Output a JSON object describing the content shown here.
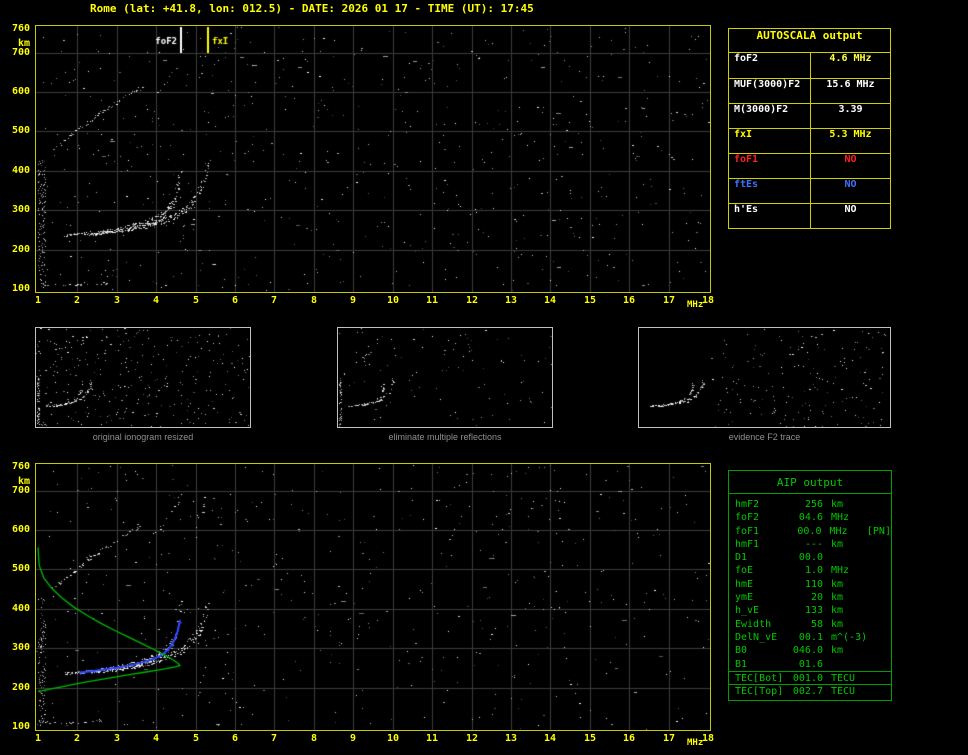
{
  "title": "Rome (lat: +41.8, lon: 012.5) - DATE: 2026 01 17 - TIME (UT): 17:45",
  "colors": {
    "background": "#000000",
    "title_text": "#ffff00",
    "axis_text": "#ffff00",
    "plot_border": "#c8c800",
    "grid_line": "#3c3c3c",
    "echo_dots": "#ffffff",
    "autoscala_border": "#d0d000",
    "aip_green": "#00c800",
    "restored_trace_blue": "#2b46ff",
    "profile_green": "#00bb00",
    "caption_gray": "#8f8f8f",
    "no_red": "#ff2020",
    "es_blue": "#4070ff"
  },
  "autoscala_table": {
    "header": "AUTOSCALA output",
    "rows": [
      {
        "label": "foF2",
        "value": "4.6 MHz",
        "label_color": "#ffffff",
        "value_color": "#ffff40"
      },
      {
        "label": "MUF(3000)F2",
        "value": "15.6 MHz",
        "label_color": "#ffffff",
        "value_color": "#ffffff"
      },
      {
        "label": "M(3000)F2",
        "value": "3.39",
        "label_color": "#ffffff",
        "value_color": "#ffffff"
      },
      {
        "label": "fxI",
        "value": "5.3 MHz",
        "label_color": "#ffff00",
        "value_color": "#ffff00"
      },
      {
        "label": "foF1",
        "value": "NO",
        "label_color": "#ff2020",
        "value_color": "#ff2020"
      },
      {
        "label": "ftEs",
        "value": "NO",
        "label_color": "#4070ff",
        "value_color": "#4070ff"
      },
      {
        "label": "h'Es",
        "value": "NO",
        "label_color": "#ffffff",
        "value_color": "#ffffff"
      }
    ]
  },
  "aip_table": {
    "header": "AIP output",
    "rows": [
      {
        "name": "hmF2",
        "value": "256",
        "unit": "km",
        "extra": ""
      },
      {
        "name": "foF2",
        "value": "04.6",
        "unit": "MHz",
        "extra": ""
      },
      {
        "name": "foF1",
        "value": "00.0",
        "unit": "MHz",
        "extra": "[PN]"
      },
      {
        "name": "hmF1",
        "value": "---",
        "unit": "km",
        "extra": ""
      },
      {
        "name": "D1",
        "value": "00.0",
        "unit": "",
        "extra": ""
      },
      {
        "name": "foE",
        "value": "1.0",
        "unit": "MHz",
        "extra": ""
      },
      {
        "name": "hmE",
        "value": "110",
        "unit": "km",
        "extra": ""
      },
      {
        "name": "ymE",
        "value": "20",
        "unit": "km",
        "extra": ""
      },
      {
        "name": "h_vE",
        "value": "133",
        "unit": "km",
        "extra": ""
      },
      {
        "name": "Ewidth",
        "value": "58",
        "unit": "km",
        "extra": ""
      },
      {
        "name": "DelN_vE",
        "value": "00.1",
        "unit": "m^(-3)",
        "extra": ""
      },
      {
        "name": "B0",
        "value": "046.0",
        "unit": "km",
        "extra": ""
      },
      {
        "name": "B1",
        "value": "01.6",
        "unit": "",
        "extra": ""
      },
      {
        "name": "TEC[Bot]",
        "value": "001.0",
        "unit": "TECU",
        "extra": "",
        "sep_before": true
      },
      {
        "name": "TEC[Top]",
        "value": "002.7",
        "unit": "TECU",
        "extra": "",
        "sep_before": true
      }
    ]
  },
  "chart_data": [
    {
      "id": "ionogram",
      "type": "scatter",
      "title": "",
      "xlim": [
        1,
        18
      ],
      "ylim": [
        100,
        760
      ],
      "xticks": [
        1,
        2,
        3,
        4,
        5,
        6,
        7,
        8,
        9,
        10,
        11,
        12,
        13,
        14,
        15,
        16,
        17,
        18
      ],
      "yticks": [
        760,
        700,
        600,
        500,
        400,
        300,
        200,
        100
      ],
      "unit_x": "MHz",
      "unit_y": "km",
      "grid": true,
      "noise_dots": 650,
      "noise_band": {
        "f": [
          1.0,
          1.18
        ],
        "km": [
          100,
          430
        ],
        "count": 140
      },
      "annotations": [
        {
          "label": "foF2",
          "x_mhz": 4.6,
          "color": "#ffffff",
          "side": "left"
        },
        {
          "label": "fxI",
          "x_mhz": 5.3,
          "color": "#ffff00",
          "side": "right"
        }
      ],
      "series": [
        {
          "key": "O",
          "name": "F2 trace O-mode",
          "points": [
            [
              1.65,
              236
            ],
            [
              1.9,
              238
            ],
            [
              2.2,
              241
            ],
            [
              2.5,
              244
            ],
            [
              2.8,
              248
            ],
            [
              3.1,
              253
            ],
            [
              3.4,
              259
            ],
            [
              3.7,
              267
            ],
            [
              3.95,
              276
            ],
            [
              4.15,
              288
            ],
            [
              4.3,
              302
            ],
            [
              4.42,
              320
            ],
            [
              4.5,
              342
            ],
            [
              4.56,
              368
            ],
            [
              4.6,
              395
            ],
            [
              4.62,
              418
            ]
          ]
        },
        {
          "key": "X",
          "name": "F2 trace X-mode",
          "points": [
            [
              2.35,
              239
            ],
            [
              2.7,
              243
            ],
            [
              3.05,
              248
            ],
            [
              3.4,
              254
            ],
            [
              3.75,
              261
            ],
            [
              4.05,
              270
            ],
            [
              4.35,
              281
            ],
            [
              4.6,
              294
            ],
            [
              4.8,
              310
            ],
            [
              4.98,
              330
            ],
            [
              5.1,
              352
            ],
            [
              5.2,
              378
            ],
            [
              5.27,
              402
            ],
            [
              5.3,
              420
            ]
          ]
        },
        {
          "key": "OBL",
          "name": "oblique spread echo",
          "points": [
            [
              1.35,
              452
            ],
            [
              1.6,
              472
            ],
            [
              1.85,
              492
            ],
            [
              2.1,
              512
            ],
            [
              2.35,
              531
            ],
            [
              2.6,
              549
            ],
            [
              2.85,
              566
            ],
            [
              3.1,
              583
            ],
            [
              3.35,
              599
            ],
            [
              3.6,
              612
            ]
          ]
        },
        {
          "key": "H2O",
          "name": "second hop O",
          "points": [
            [
              3.95,
              590
            ],
            [
              4.15,
              612
            ],
            [
              4.35,
              638
            ],
            [
              4.5,
              664
            ],
            [
              4.6,
              690
            ],
            [
              4.68,
              714
            ]
          ]
        },
        {
          "key": "H2X",
          "name": "second hop X",
          "points": [
            [
              4.95,
              598
            ],
            [
              5.08,
              630
            ],
            [
              5.18,
              668
            ],
            [
              5.26,
              705
            ]
          ]
        },
        {
          "key": "E",
          "name": "E-region echo",
          "points": [
            [
              1.05,
              113
            ],
            [
              1.5,
              111
            ],
            [
              1.95,
              111
            ],
            [
              2.4,
              113
            ],
            [
              2.8,
              116
            ]
          ]
        }
      ]
    },
    {
      "id": "thumb_original",
      "type": "scatter",
      "title": "original ionogram resized",
      "xlim": [
        1,
        18
      ],
      "ylim": [
        100,
        760
      ],
      "series_ref": [
        "O",
        "X",
        "OBL",
        "H2O",
        "H2X",
        "E"
      ],
      "noise_dots": 300,
      "noise_band": {
        "f": [
          1.0,
          1.18
        ],
        "km": [
          100,
          430
        ],
        "count": 60
      }
    },
    {
      "id": "thumb_no_multiples",
      "type": "scatter",
      "title": "eliminate multiple reflections",
      "xlim": [
        1,
        18
      ],
      "ylim": [
        100,
        760
      ],
      "series_ref": [
        "O",
        "X",
        "OBL"
      ],
      "noise_dots": 100,
      "noise_band": {
        "f": [
          1.0,
          1.18
        ],
        "km": [
          100,
          430
        ],
        "count": 40
      }
    },
    {
      "id": "thumb_f2_trace",
      "type": "scatter",
      "title": "evidence F2 trace",
      "xlim": [
        1,
        18
      ],
      "ylim": [
        100,
        760
      ],
      "series_ref": [
        "O",
        "X"
      ],
      "noise_dots": 190,
      "noise_bias": "upper-right"
    },
    {
      "id": "ionogram_with_profile",
      "type": "scatter",
      "title": "",
      "xlim": [
        1,
        18
      ],
      "ylim": [
        100,
        760
      ],
      "xticks": [
        1,
        2,
        3,
        4,
        5,
        6,
        7,
        8,
        9,
        10,
        11,
        12,
        13,
        14,
        15,
        16,
        17,
        18
      ],
      "yticks": [
        760,
        700,
        600,
        500,
        400,
        300,
        200,
        100
      ],
      "unit_x": "MHz",
      "unit_y": "km",
      "grid": true,
      "noise_dots": 520,
      "noise_band": {
        "f": [
          1.0,
          1.18
        ],
        "km": [
          100,
          430
        ],
        "count": 120
      },
      "annotations": [],
      "series_ref": [
        "O",
        "X",
        "OBL",
        "H2O",
        "H2X",
        "E"
      ],
      "series": [
        {
          "key": "RESTORED",
          "name": "autoscaled F2 trace",
          "color": "#2b46ff",
          "style": "line+dots",
          "points": [
            [
              2.05,
              238
            ],
            [
              2.4,
              242
            ],
            [
              2.75,
              247
            ],
            [
              3.1,
              252
            ],
            [
              3.45,
              259
            ],
            [
              3.8,
              268
            ],
            [
              4.1,
              280
            ],
            [
              4.3,
              296
            ],
            [
              4.45,
              318
            ],
            [
              4.55,
              345
            ],
            [
              4.6,
              372
            ]
          ]
        },
        {
          "key": "PROFILE",
          "name": "electron density profile N(h)",
          "color": "#00bb00",
          "style": "line",
          "points": [
            [
              1.0,
              190
            ],
            [
              1.3,
              196
            ],
            [
              1.6,
              202
            ],
            [
              1.9,
              208
            ],
            [
              2.2,
              214
            ],
            [
              2.5,
              219
            ],
            [
              2.8,
              224
            ],
            [
              3.1,
              229
            ],
            [
              3.4,
              234
            ],
            [
              3.7,
              239
            ],
            [
              4.0,
              244
            ],
            [
              4.25,
              248
            ],
            [
              4.45,
              252
            ],
            [
              4.6,
              256
            ],
            [
              4.55,
              262
            ],
            [
              4.4,
              272
            ],
            [
              4.2,
              283
            ],
            [
              3.95,
              296
            ],
            [
              3.65,
              311
            ],
            [
              3.3,
              328
            ],
            [
              2.95,
              345
            ],
            [
              2.6,
              363
            ],
            [
              2.25,
              383
            ],
            [
              1.9,
              405
            ],
            [
              1.6,
              428
            ],
            [
              1.35,
              452
            ],
            [
              1.15,
              478
            ],
            [
              1.03,
              510
            ],
            [
              1.0,
              556
            ]
          ]
        }
      ]
    }
  ]
}
